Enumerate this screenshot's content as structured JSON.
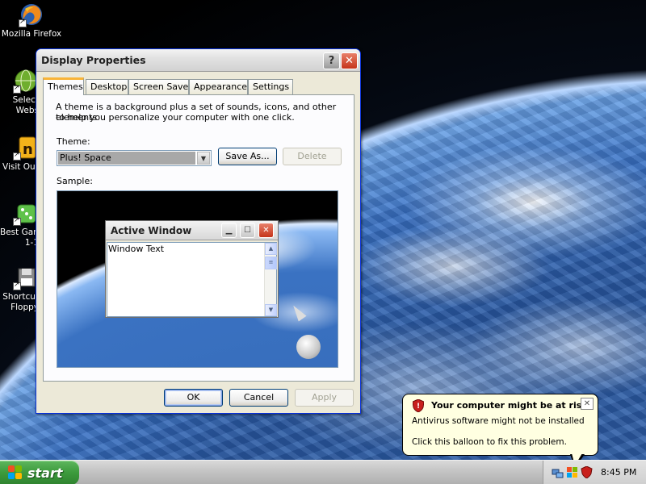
{
  "desktop": {
    "icons": [
      {
        "label": "Mozilla Firefox",
        "icon": "firefox-icon"
      },
      {
        "label": "Select",
        "label2": "Webs",
        "icon": "globe-icon"
      },
      {
        "label": "Visit Our",
        "icon": "game-icon"
      },
      {
        "label": "Best Gam",
        "label2": "1-1",
        "icon": "dice-icon"
      },
      {
        "label": "Shortcut",
        "label2": "Floppy",
        "icon": "floppy-icon"
      }
    ]
  },
  "dialog": {
    "title": "Display Properties",
    "tabs": [
      "Themes",
      "Desktop",
      "Screen Saver",
      "Appearance",
      "Settings"
    ],
    "active_tab": "Themes",
    "description_line1": "A theme is a background plus a set of sounds, icons, and other elements",
    "description_line2": "to help you personalize your computer with one click.",
    "theme_label": "Theme:",
    "theme_value": "Plus! Space",
    "save_as_label": "Save As...",
    "delete_label": "Delete",
    "sample_label": "Sample:",
    "sample": {
      "window_title": "Active Window",
      "window_text": "Window Text"
    },
    "ok_label": "OK",
    "cancel_label": "Cancel",
    "apply_label": "Apply"
  },
  "taskbar": {
    "start_label": "start",
    "clock": "8:45 PM"
  },
  "balloon": {
    "title": "Your computer might be at risk",
    "line1": "Antivirus software might not be installed",
    "line2": "Click this balloon to fix this problem."
  },
  "colors": {
    "start_green": "#3c9a3c",
    "dialog_bg": "#ece9d8",
    "balloon_bg": "#ffffe1",
    "close_red": "#c5341a"
  }
}
